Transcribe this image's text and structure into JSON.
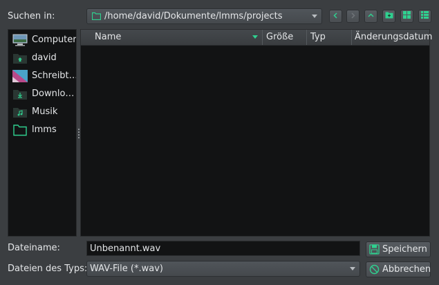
{
  "dialog": {
    "look_in_label": "Suchen in:",
    "path": "/home/david/Dokumente/lmms/projects",
    "nav_buttons": [
      "back-icon",
      "forward-icon",
      "parent-directory-icon",
      "new-folder-icon",
      "list-view-icon",
      "detail-view-icon"
    ]
  },
  "sidebar": {
    "items": [
      {
        "label": "Computer",
        "icon": "computer-icon"
      },
      {
        "label": "david",
        "icon": "home-folder-icon"
      },
      {
        "label": "Schreibt…",
        "icon": "desktop-icon"
      },
      {
        "label": "Downlo…",
        "icon": "downloads-folder-icon"
      },
      {
        "label": "Musik",
        "icon": "music-folder-icon"
      },
      {
        "label": "lmms",
        "icon": "folder-icon"
      }
    ]
  },
  "file_list": {
    "columns": [
      "Name",
      "Größe",
      "Typ",
      "Änderungsdatum"
    ],
    "sort_column": "Name",
    "rows": []
  },
  "bottom": {
    "filename_label": "Dateiname:",
    "filename_value": "Unbenannt.wav",
    "filetype_label": "Dateien des Typs:",
    "filetype_value": "WAV-File (*.wav)",
    "save_label": "Speichern",
    "cancel_label": "Abbrechen"
  },
  "colors": {
    "accent": "#2fd08f",
    "background": "#3b3e41",
    "panel": "#121314"
  }
}
